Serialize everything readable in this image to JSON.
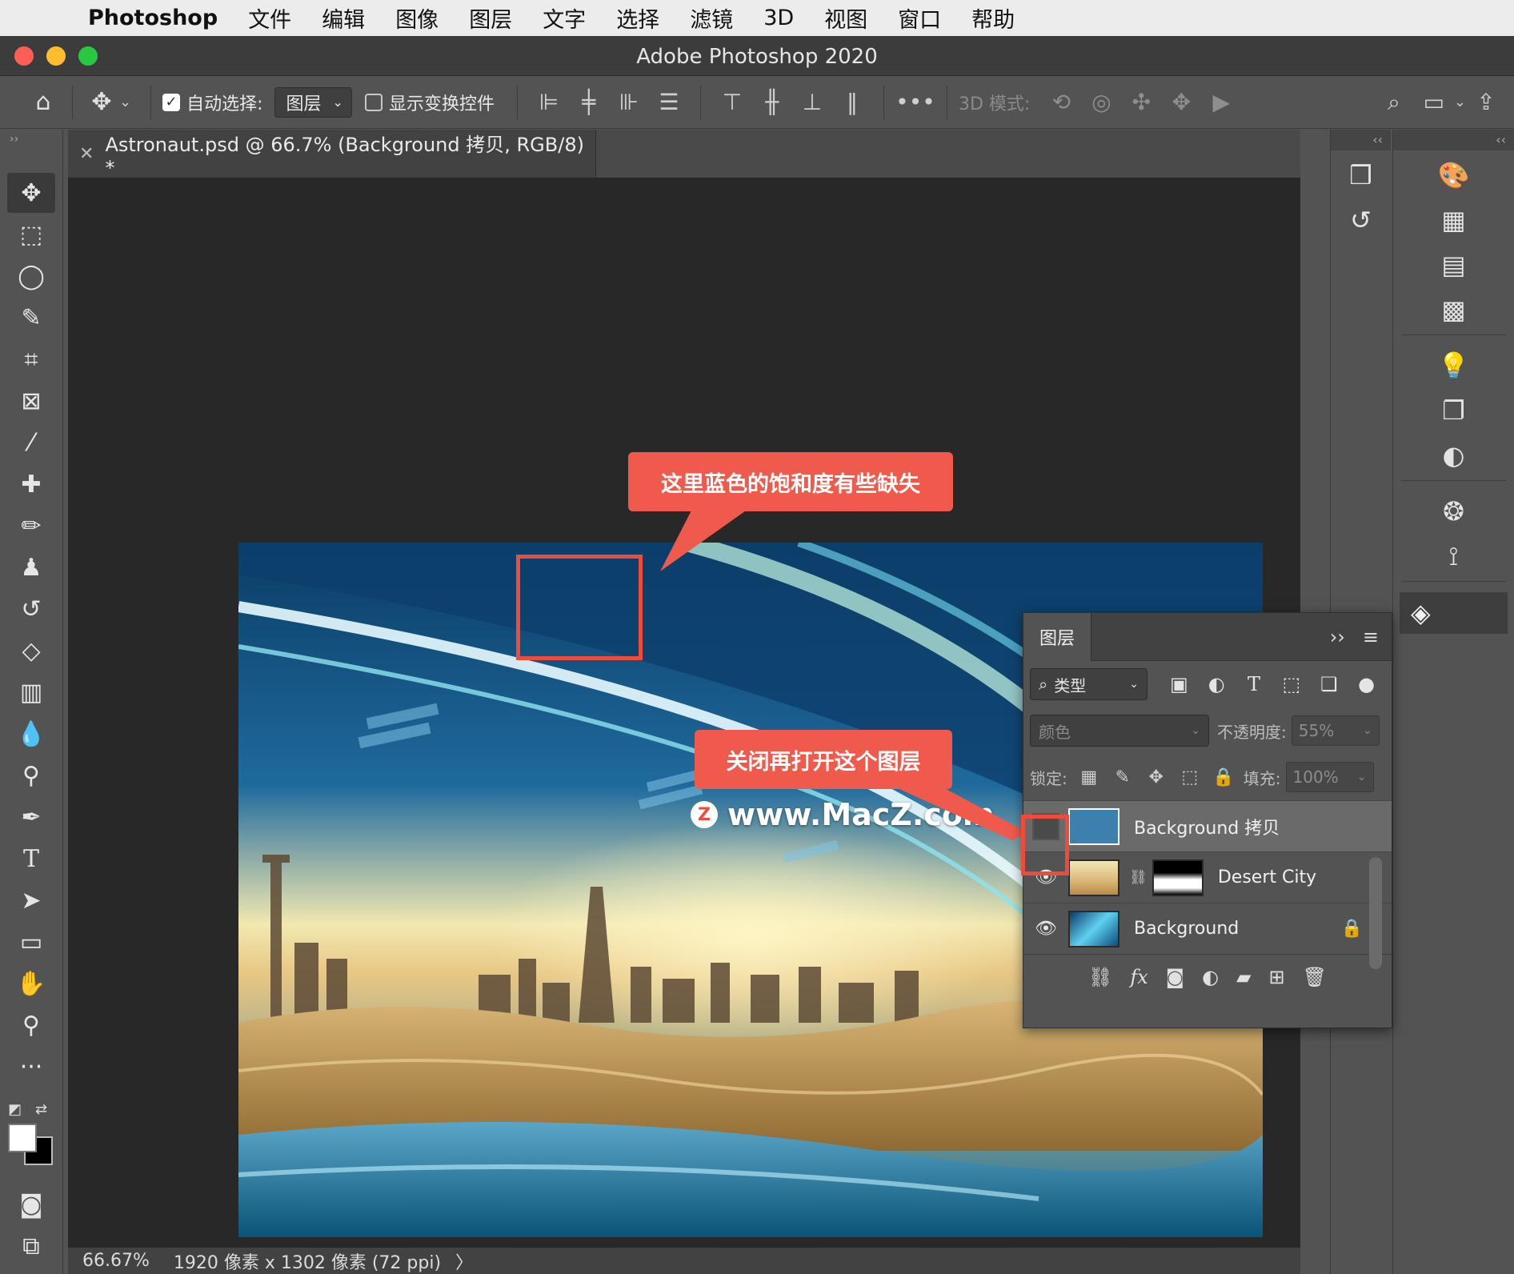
{
  "menubar": {
    "app": "Photoshop",
    "items": [
      "文件",
      "编辑",
      "图像",
      "图层",
      "文字",
      "选择",
      "滤镜",
      "3D",
      "视图",
      "窗口",
      "帮助"
    ]
  },
  "window": {
    "title": "Adobe Photoshop 2020"
  },
  "options": {
    "auto_select_label": "自动选择:",
    "auto_select_value": "图层",
    "transform_label": "显示变换控件",
    "mode_3d_label": "3D 模式:",
    "more_label": "•••"
  },
  "document": {
    "tab_title": "Astronaut.psd @ 66.7% (Background 拷贝, RGB/8) *",
    "watermark": "www.MacZ.com",
    "watermark_badge": "Z"
  },
  "status": {
    "zoom": "66.67%",
    "dimensions": "1920 像素 x 1302 像素 (72 ppi)",
    "arrow": "〉"
  },
  "annotations": {
    "callout_top": "这里蓝色的饱和度有些缺失",
    "callout_bottom": "关闭再打开这个图层"
  },
  "layers_panel": {
    "tab": "图层",
    "filter_label": "类型",
    "blend_mode": "颜色",
    "opacity_label": "不透明度:",
    "opacity_value": "55%",
    "lock_label": "锁定:",
    "fill_label": "填充:",
    "fill_value": "100%",
    "layers": [
      {
        "name": "Background 拷贝",
        "visible": false,
        "selected": true
      },
      {
        "name": "Desert City",
        "visible": true,
        "selected": false
      },
      {
        "name": "Background",
        "visible": true,
        "selected": false,
        "locked": true
      }
    ]
  },
  "colors": {
    "accent_callout": "#ef5a4c",
    "panel_bg": "#535353",
    "canvas_bg": "#282828"
  },
  "icons": {
    "tools": [
      "move-icon",
      "marquee-icon",
      "lasso-icon",
      "quick-select-icon",
      "crop-icon",
      "frame-icon",
      "eyedropper-icon",
      "healing-icon",
      "brush-icon",
      "stamp-icon",
      "history-brush-icon",
      "eraser-icon",
      "gradient-icon",
      "blur-icon",
      "dodge-icon",
      "pen-icon",
      "type-icon",
      "path-select-icon",
      "rectangle-icon",
      "hand-icon",
      "zoom-icon",
      "more-tools-icon"
    ]
  }
}
